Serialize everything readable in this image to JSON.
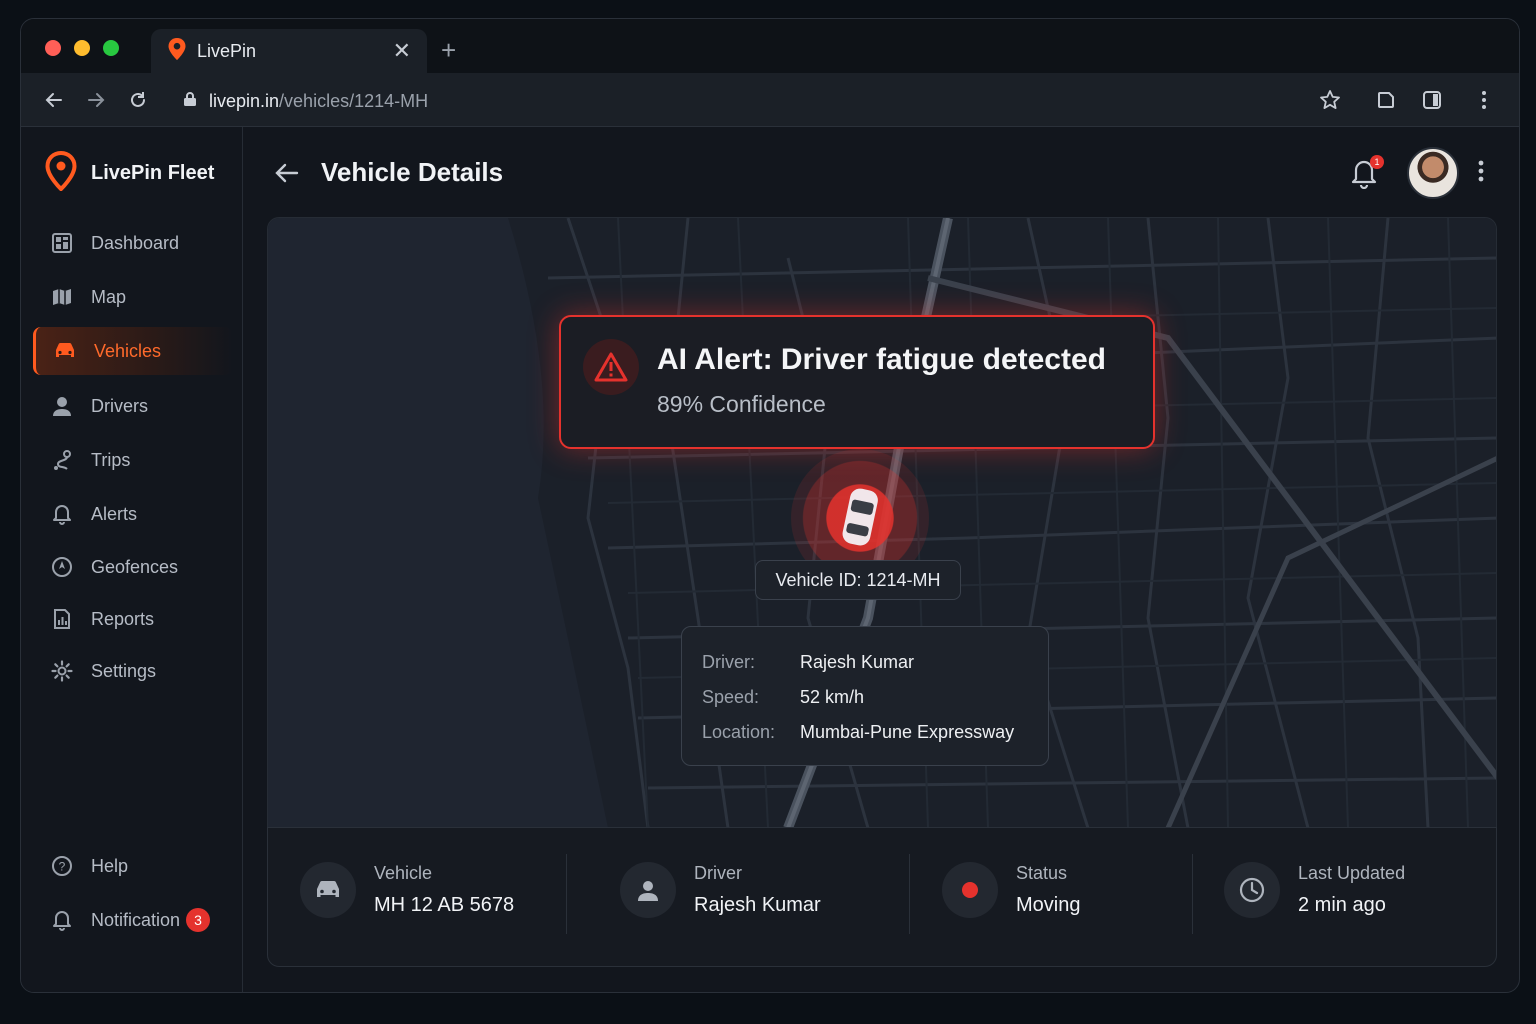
{
  "browser": {
    "tab_title": "LivePin",
    "url_host": "livepin.in",
    "url_path": "/vehicles/1214-MH"
  },
  "sidebar": {
    "brand": "LivePin Fleet",
    "items": [
      {
        "label": "Dashboard",
        "icon": "dashboard-icon"
      },
      {
        "label": "Map",
        "icon": "map-icon"
      },
      {
        "label": "Vehicles",
        "icon": "car-icon",
        "active": true
      },
      {
        "label": "Drivers",
        "icon": "user-icon"
      },
      {
        "label": "Trips",
        "icon": "route-icon"
      },
      {
        "label": "Alerts",
        "icon": "bell-icon"
      },
      {
        "label": "Geofences",
        "icon": "geofence-icon"
      },
      {
        "label": "Reports",
        "icon": "report-icon"
      },
      {
        "label": "Settings",
        "icon": "gear-icon"
      }
    ],
    "help_label": "Help",
    "notification_label": "Notification",
    "notification_count": "3"
  },
  "header": {
    "title": "Vehicle Details",
    "bell_badge": "1"
  },
  "alert": {
    "title": "AI Alert: Driver fatigue detected",
    "confidence": "89% Confidence"
  },
  "vehicle_pill": "Vehicle ID: 1214-MH",
  "info": {
    "driver_label": "Driver:",
    "driver_value": "Rajesh Kumar",
    "speed_label": "Speed:",
    "speed_value": "52 km/h",
    "location_label": "Location:",
    "location_value": "Mumbai-Pune Expressway"
  },
  "stats": {
    "vehicle_label": "Vehicle",
    "vehicle_value": "MH 12 AB 5678",
    "driver_label": "Driver",
    "driver_value": "Rajesh Kumar",
    "status_label": "Status",
    "status_value": "Moving",
    "updated_label": "Last Updated",
    "updated_value": "2 min ago"
  },
  "colors": {
    "accent": "#ff5a1f",
    "alert_red": "#e5322d",
    "background": "#12161d"
  }
}
